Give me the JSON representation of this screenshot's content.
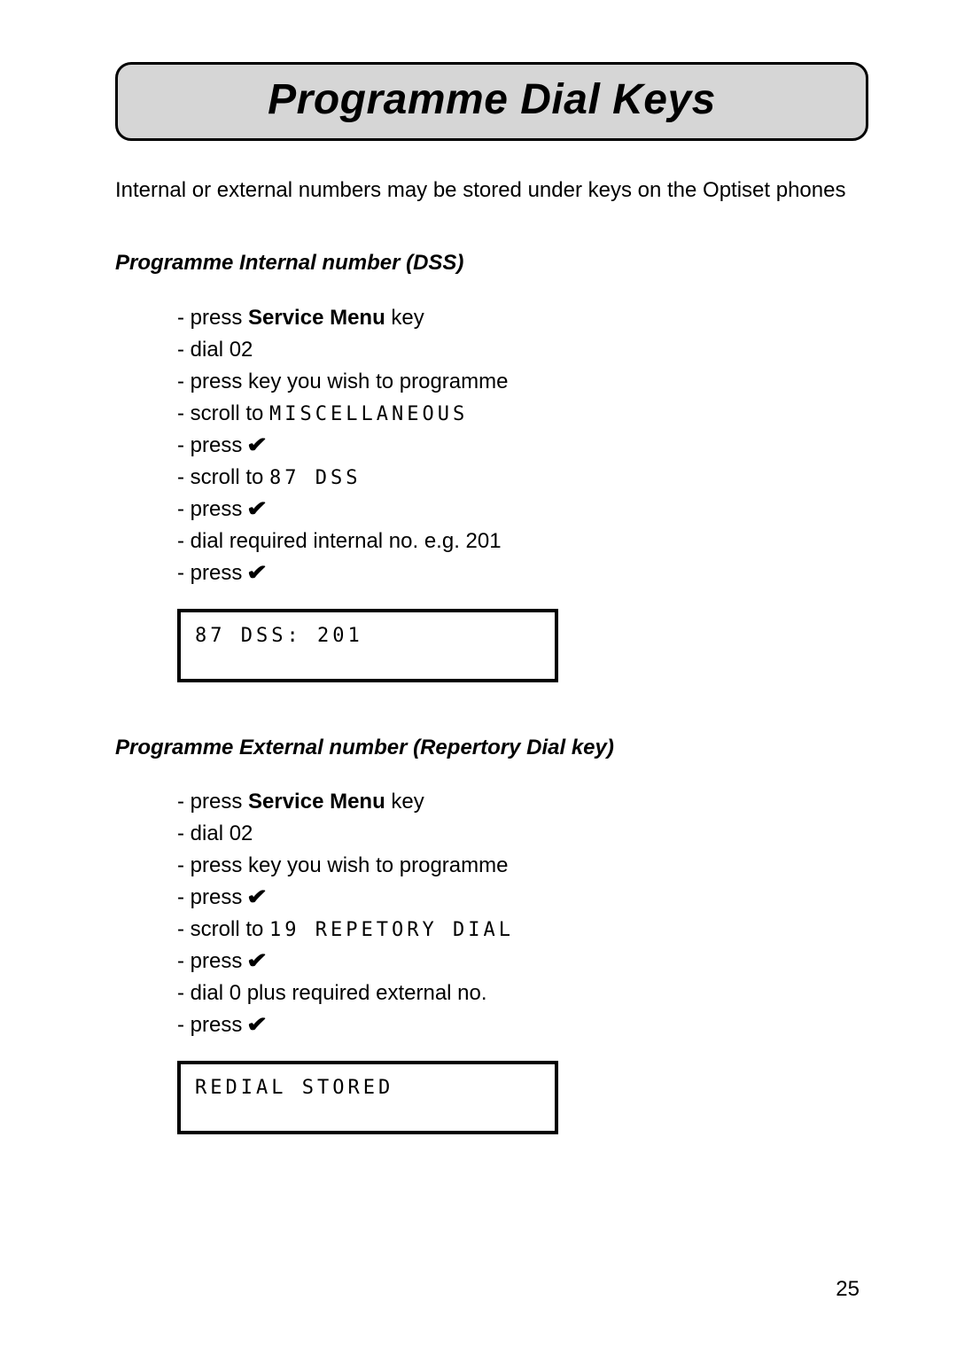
{
  "title": "Programme Dial Keys",
  "intro": "Internal or external numbers may be stored under keys on the Optiset phones",
  "section1": {
    "heading": "Programme Internal number (DSS)",
    "steps": {
      "s1_pre": "- press ",
      "s1_kw": "Service Menu",
      "s1_post": " key",
      "s2": "- dial 02",
      "s3": "- press key you wish to programme",
      "s4_pre": "- scroll to  ",
      "s4_lcd": "MISCELLANEOUS",
      "s5": "- press ",
      "s6_pre": "- scroll to  ",
      "s6_lcd": "87 DSS",
      "s7": "- press  ",
      "s8": "- dial required internal no. e.g. 201",
      "s9": "- press  "
    },
    "display": "87 DSS: 201"
  },
  "section2": {
    "heading": "Programme External number (Repertory Dial key)",
    "steps": {
      "s1_pre": "- press ",
      "s1_kw": "Service Menu",
      "s1_post": " key",
      "s2": "- dial 02",
      "s3": "- press key you wish to programme",
      "s4": "- press ",
      "s5_pre": "- scroll to  ",
      "s5_lcd": "19 REPETORY DIAL",
      "s6": "- press  ",
      "s7": "- dial 0 plus required external no.",
      "s8": "- press  "
    },
    "display": "REDIAL STORED"
  },
  "check_mark": "✔",
  "page_number": "25"
}
